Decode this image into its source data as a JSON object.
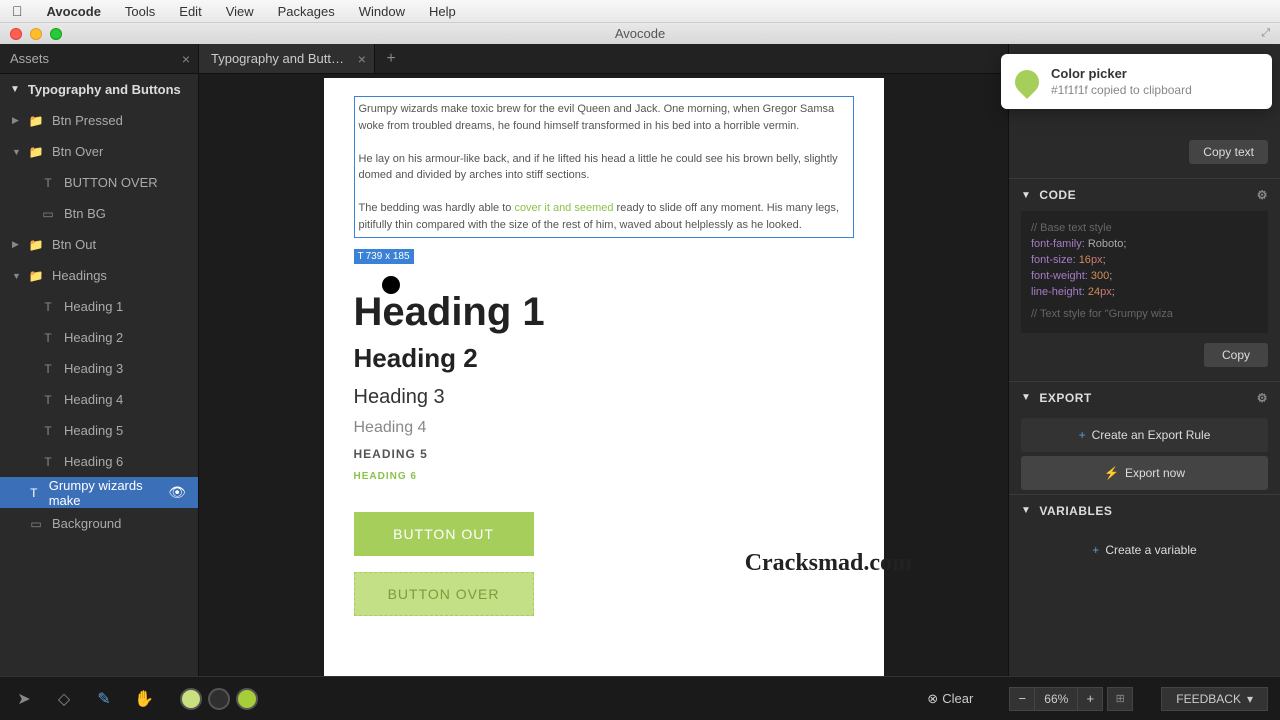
{
  "menu": {
    "app": "Avocode",
    "items": [
      "Tools",
      "Edit",
      "View",
      "Packages",
      "Window",
      "Help"
    ]
  },
  "window": {
    "title": "Avocode"
  },
  "sidebar": {
    "tab": "Assets",
    "title": "Typography and Buttons",
    "layers": [
      {
        "label": "Btn Pressed",
        "icon": "folder",
        "disclose": true
      },
      {
        "label": "Btn Over",
        "icon": "folder",
        "disclose": true,
        "open": true
      },
      {
        "label": "BUTTON OVER",
        "icon": "text",
        "indent": true
      },
      {
        "label": "Btn BG",
        "icon": "shape",
        "indent": true
      },
      {
        "label": "Btn Out",
        "icon": "folder",
        "disclose": true
      },
      {
        "label": "Headings",
        "icon": "folder",
        "disclose": true,
        "open": true
      },
      {
        "label": "Heading 1",
        "icon": "text",
        "indent": true
      },
      {
        "label": "Heading 2",
        "icon": "text",
        "indent": true
      },
      {
        "label": "Heading 3",
        "icon": "text",
        "indent": true
      },
      {
        "label": "Heading 4",
        "icon": "text",
        "indent": true
      },
      {
        "label": "Heading 5",
        "icon": "text",
        "indent": true
      },
      {
        "label": "Heading 6",
        "icon": "text",
        "indent": true
      },
      {
        "label": "Grumpy wizards make",
        "icon": "text",
        "selected": true,
        "eye": true
      },
      {
        "label": "Background",
        "icon": "shape"
      }
    ]
  },
  "canvas": {
    "tab": "Typography and Butt…",
    "paragraph1": "Grumpy wizards make toxic brew for the evil Queen and Jack. One morning, when Gregor Samsa woke from troubled dreams, he found himself transformed in his bed into a horrible vermin.",
    "paragraph2a": "He lay on his armour-like back, and if he lifted his head a little he could see his brown belly, slightly domed and divided by arches into stiff sections.",
    "paragraph3a": "The bedding was hardly able to ",
    "paragraph3link": "cover it and seemed",
    "paragraph3b": " ready to slide off any moment. His many legs, pitifully thin compared with the size of the rest of him, waved about helplessly as he looked.",
    "size_badge": "739 x 185",
    "headings": {
      "h1": "Heading 1",
      "h2": "Heading 2",
      "h3": "Heading 3",
      "h4": "Heading 4",
      "h5": "HEADING 5",
      "h6": "HEADING 6"
    },
    "buttons": {
      "out": "BUTTON OUT",
      "over": "BUTTON OVER"
    },
    "watermark": "Cracksmad.com"
  },
  "toast": {
    "title": "Color picker",
    "subtitle": "#1f1f1f copied to clipboard"
  },
  "right": {
    "copy_text": "Copy text",
    "code": {
      "title": "CODE"
    },
    "css": {
      "cmt1": "//  Base text style",
      "l1a": "font-family:",
      "l1b": " Roboto;",
      "l2a": "font-size: ",
      "l2n": "16",
      "l2u": "px",
      "l2c": ";",
      "l3a": "font-weight: ",
      "l3n": "300",
      "l3c": ";",
      "l4a": "line-height: ",
      "l4n": "24",
      "l4u": "px",
      "l4c": ";",
      "cmt2": "//  Text style for \"Grumpy wiza"
    },
    "copy": "Copy",
    "export": {
      "title": "EXPORT",
      "create_rule": "Create an Export Rule",
      "export_now": "Export now"
    },
    "variables": {
      "title": "VARIABLES",
      "create": "Create a variable"
    }
  },
  "bottom": {
    "clear": "Clear",
    "zoom": "66%",
    "feedback": "FEEDBACK",
    "swatches": [
      "#c8e080",
      "#2f2f2f",
      "#a6ce39"
    ]
  }
}
